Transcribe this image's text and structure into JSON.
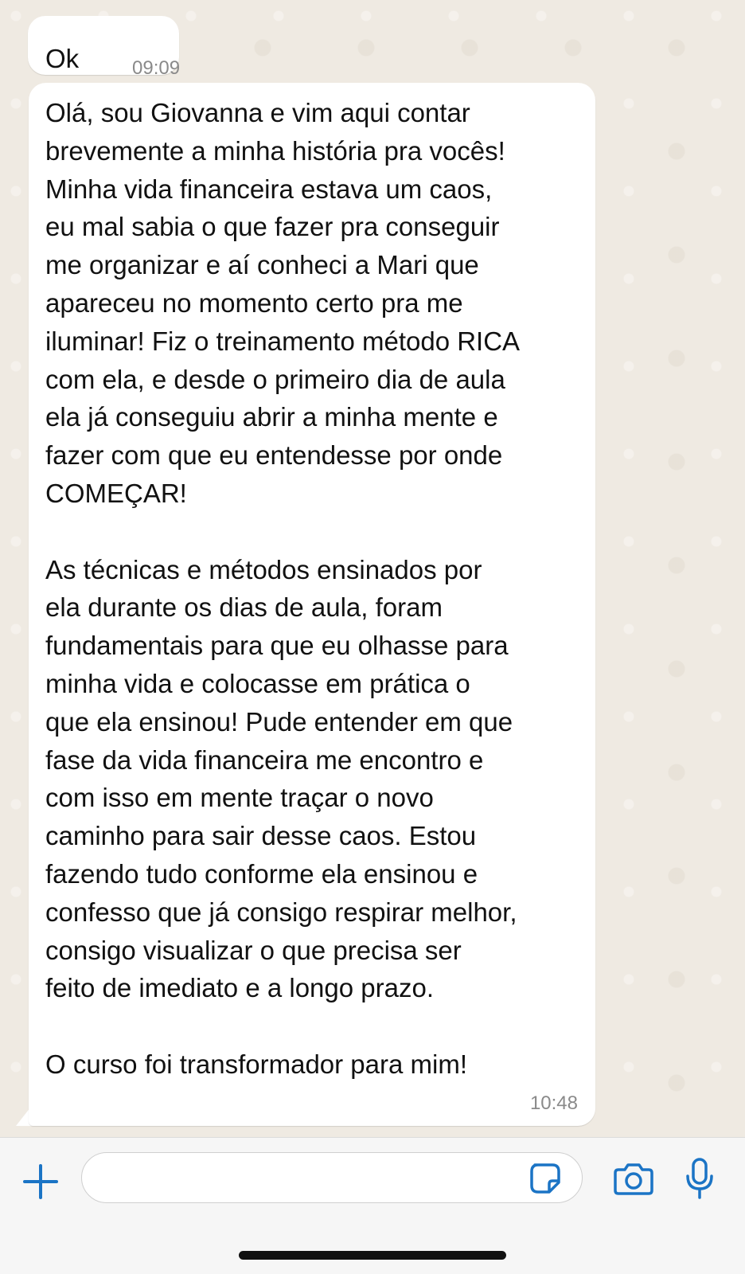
{
  "colors": {
    "chat_background": "#efeae2",
    "bubble": "#ffffff",
    "icon_accent": "#1b74c5",
    "timestamp": "#8a8a8a"
  },
  "messages": [
    {
      "text": "Ok",
      "time": "09:09"
    },
    {
      "text": "Olá, sou Giovanna e vim aqui contar\nbrevemente a minha história pra vocês!\nMinha vida financeira estava um caos,\neu mal sabia o que fazer pra conseguir\nme organizar e aí conheci a Mari que\napareceu no momento certo pra me\niluminar! Fiz o treinamento método RICA\ncom ela, e desde o primeiro dia de aula\nela já conseguiu abrir a minha mente e\nfazer com que eu entendesse por onde\nCOMEÇAR!\n\nAs técnicas e métodos ensinados por\nela durante os dias de aula, foram\nfundamentais para que eu olhasse para\nminha vida e colocasse em prática o\nque ela ensinou! Pude entender em que\nfase da vida financeira me encontro e\ncom isso em mente traçar o novo\ncaminho para sair desse caos. Estou\nfazendo tudo conforme ela ensinou e\nconfesso que já consigo respirar melhor,\nconsigo visualizar o que precisa ser\nfeito de imediato e a longo prazo.\n\nO curso foi transformador para mim!",
      "time": "10:48"
    }
  ],
  "composer": {
    "input_value": "",
    "icons": {
      "add": "plus-icon",
      "sticker": "sticker-icon",
      "camera": "camera-icon",
      "microphone": "microphone-icon"
    }
  }
}
